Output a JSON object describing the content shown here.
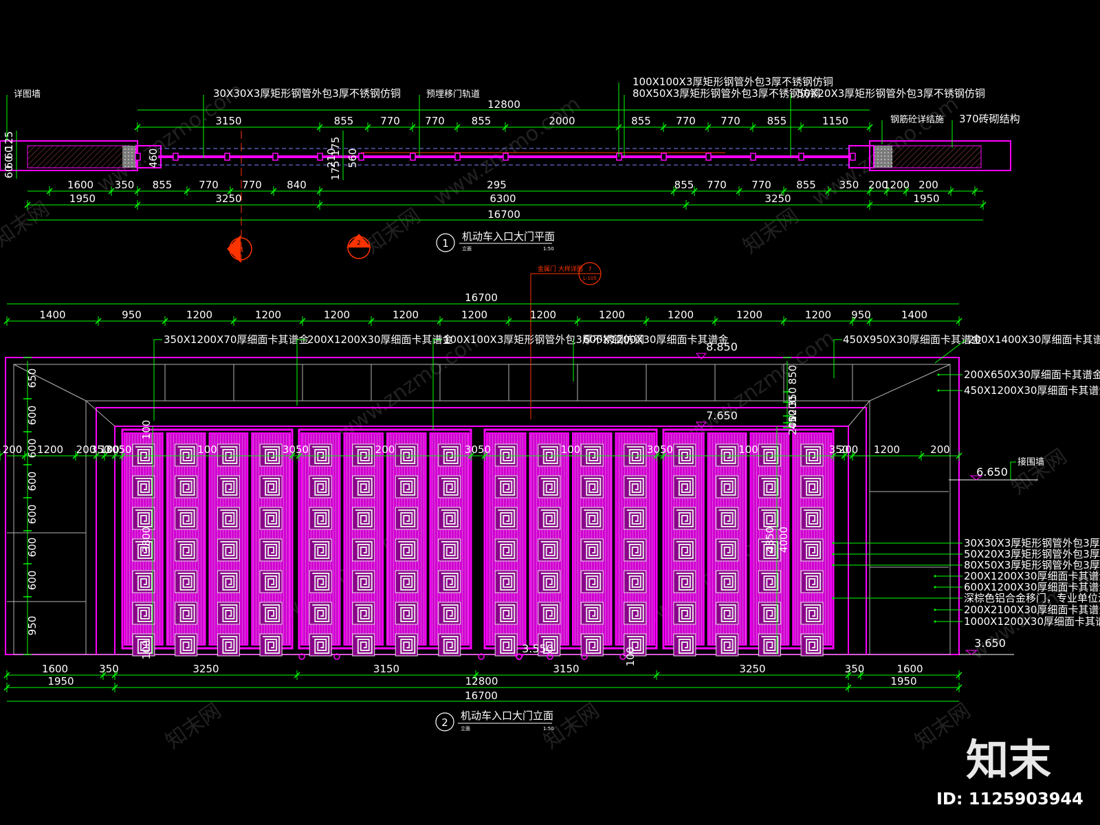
{
  "colors": {
    "background": "#000000",
    "gate": "#ff00ff",
    "dimension": "#00ff00",
    "text": "#ffffff",
    "section_mark": "#ff3300",
    "wall": "#ff00ff",
    "red_line": "#ff3300",
    "gray": "#b4b4b4"
  },
  "plan": {
    "title": "机动车入口大门平面",
    "number": "1",
    "sub_left": "立面",
    "sub_right": "1:50",
    "notes": {
      "wall_left": "详图墙",
      "tube_30": "30X30X3厚矩形钢管外包3厚不锈钢仿铜",
      "rail": "预埋移门轨道",
      "tube_100": "100X100X3厚矩形钢管外包3厚不锈钢仿铜",
      "tube_80": "80X50X3厚矩形钢管外包3厚不锈钢仿铜",
      "tube_50": "50X20X3厚矩形钢管外包3厚不锈钢仿铜",
      "wall_detail": "钢筋砼详结施",
      "brick": "370砖砌结构"
    },
    "dims_top": {
      "total": "12800",
      "row": [
        "3150",
        "855",
        "770",
        "770",
        "855",
        "2000",
        "855",
        "770",
        "770",
        "855",
        "1150"
      ]
    },
    "dims_bottom1": [
      "1600",
      "350",
      "855",
      "770",
      "770",
      "840",
      "295",
      "855",
      "770",
      "770",
      "855",
      "350",
      "200",
      "1200",
      "200"
    ],
    "dims_bottom2": [
      "1950",
      "3250",
      "6300",
      "3250",
      "1950"
    ],
    "dims_bottom3": "16700",
    "dims_left": [
      "125",
      "60",
      "60",
      "60"
    ],
    "dims_mid_v": [
      "460",
      "210",
      "175",
      "175",
      "560"
    ]
  },
  "elevation": {
    "title": "机动车入口大门立面",
    "number": "2",
    "sub_left": "立面",
    "sub_right": "1:50",
    "callout_text": "金属门 大样详图",
    "callout_number": "7",
    "callout_ref": "L-105",
    "dims_top_total": "16700",
    "dims_top": [
      "1400",
      "950",
      "1200",
      "1200",
      "1200",
      "1200",
      "1200",
      "1200",
      "1200",
      "1200",
      "1200",
      "1200",
      "950",
      "1400"
    ],
    "dims_mid": [
      "200",
      "1200",
      "200",
      "350",
      "100",
      "3050",
      "100",
      "3050",
      "200",
      "3050",
      "100",
      "3050",
      "100",
      "350",
      "200",
      "1200",
      "200"
    ],
    "dims_left": [
      "650",
      "600",
      "600",
      "600",
      "600",
      "600",
      "600",
      "950"
    ],
    "dims_right": [
      "850",
      "350",
      "1200",
      "450",
      "200"
    ],
    "dims_inner_v": [
      "100",
      "3800",
      "100",
      "4350",
      "4000"
    ],
    "levels": [
      "8.850",
      "7.650",
      "6.650",
      "3.550",
      "3.650"
    ],
    "dims_bottom1": [
      "1600",
      "350",
      "3250",
      "3150",
      "3150",
      "3250",
      "350",
      "1600"
    ],
    "dims_bottom2": [
      "1950",
      "12800",
      "1950"
    ],
    "dims_bottom3": "16700",
    "notes_top": {
      "n1": "350X1200X70厚细面卡其谱金",
      "n2": "200X1200X30厚细面卡其谱金",
      "n3": "100X100X3厚矩形钢管外包3厚不锈钢仿铜",
      "n4": "600X1200X30厚细面卡其谱金",
      "n5": "450X950X30厚细面卡其谱金",
      "n6": "200X1400X30厚细面卡其谱金"
    },
    "notes_right": [
      "200X650X30厚细面卡其谱金",
      "450X1200X30厚细面卡其谱金",
      "接围墙",
      "30X30X3厚矩形钢管外包3厚不锈钢仿铜",
      "50X20X3厚矩形钢管外包3厚不锈钢仿铜",
      "80X50X3厚矩形钢管外包3厚不锈钢仿铜",
      "200X1200X30厚细面卡其谱金",
      "600X1200X30厚细面卡其谱金",
      "深棕色铝合金移门，专业单位深化",
      "200X2100X30厚细面卡其谱金",
      "1000X1200X30厚细面卡其谱金"
    ]
  },
  "section_marks": [
    {
      "label": "1"
    },
    {
      "label": "2"
    }
  ],
  "watermark": {
    "text_cn": "知末网",
    "text_url": "www.znzmo.com",
    "logo": "知末",
    "id": "ID: 1125903944"
  }
}
